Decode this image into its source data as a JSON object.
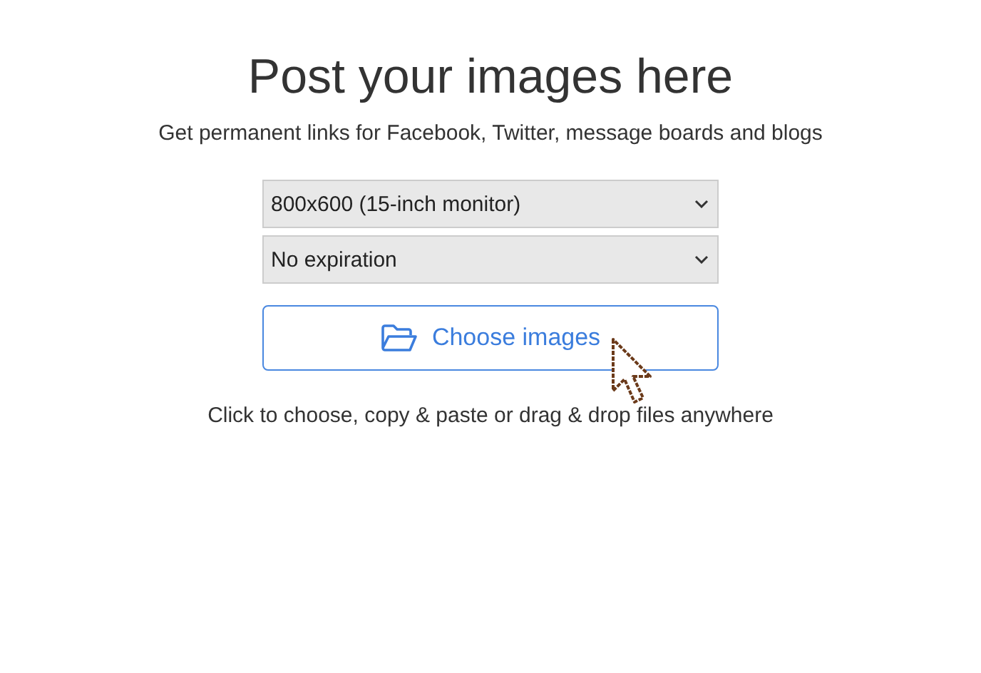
{
  "heading": "Post your images here",
  "subtitle": "Get permanent links for Facebook, Twitter, message boards and blogs",
  "selects": [
    {
      "value": "800x600 (15-inch monitor)"
    },
    {
      "value": "No expiration"
    }
  ],
  "upload_button": {
    "label": "Choose images"
  },
  "hint": "Click to choose, copy & paste or drag & drop files anywhere"
}
